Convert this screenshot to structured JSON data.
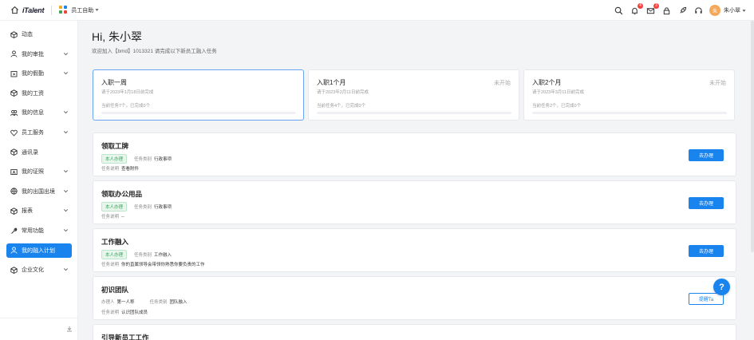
{
  "topbar": {
    "logo": "iTalent",
    "app_switch_label": "员工自助",
    "badges": {
      "bell": "4",
      "mail": "3"
    },
    "user_avatar": "朱",
    "user_name": "朱小翠",
    "icons": [
      "search-icon",
      "bell-icon",
      "mail-icon",
      "lock-icon",
      "rocket-icon",
      "headset-icon"
    ]
  },
  "sidebar": {
    "items": [
      {
        "label": "动态",
        "icon": "cube-icon",
        "chevron": false
      },
      {
        "label": "我的审批",
        "icon": "user-icon",
        "chevron": true
      },
      {
        "label": "我的假勤",
        "icon": "calendar-icon",
        "chevron": true
      },
      {
        "label": "我的工资",
        "icon": "cube-icon",
        "chevron": false
      },
      {
        "label": "我的信息",
        "icon": "users-icon",
        "chevron": true
      },
      {
        "label": "员工服务",
        "icon": "heart-icon",
        "chevron": true
      },
      {
        "label": "通讯录",
        "icon": "cube-icon",
        "chevron": false
      },
      {
        "label": "我的证照",
        "icon": "id-card-icon",
        "chevron": true
      },
      {
        "label": "我的出国出境",
        "icon": "globe-icon",
        "chevron": true
      },
      {
        "label": "报表",
        "icon": "cube-icon",
        "chevron": true
      },
      {
        "label": "常用功能",
        "icon": "tool-icon",
        "chevron": true
      },
      {
        "label": "我的融入计划",
        "icon": "user-icon",
        "chevron": false,
        "active": true
      },
      {
        "label": "企业文化",
        "icon": "cube-icon",
        "chevron": true
      }
    ]
  },
  "main": {
    "greeting": "Hi, 朱小翠",
    "subtitle": "欢迎加入【bmd】1013321 请完成以下新员工融入任务",
    "stages": [
      {
        "title": "入职一周",
        "date": "请于2023年1月18日前完成",
        "status": "",
        "progress": "当前任务7个，已完成0个",
        "fraction": 0
      },
      {
        "title": "入职1个月",
        "date": "请于2023年2月11日前完成",
        "status": "未开始",
        "progress": "当前任务4个，已完成0个",
        "fraction": 0
      },
      {
        "title": "入职2个月",
        "date": "请于2023年3月11日前完成",
        "status": "未开始",
        "progress": "当前任务2个，已完成0个",
        "fraction": 0
      }
    ],
    "tasks": [
      {
        "title": "领取工牌",
        "tag": "本人办理",
        "type_label": "任务类别",
        "type_value": "行政事项",
        "desc_label": "任务说明",
        "desc_value": "查看附件",
        "button": "去办理"
      },
      {
        "title": "领取办公用品",
        "tag": "本人办理",
        "type_label": "任务类别",
        "type_value": "行政事项",
        "desc_label": "任务说明",
        "desc_value": "--",
        "button": "去办理"
      },
      {
        "title": "工作融入",
        "tag": "本人办理",
        "type_label": "任务类别",
        "type_value": "工作融入",
        "desc_label": "任务说明",
        "desc_value": "你的直属领导会带领你熟悉你要负责的工作",
        "button": "去办理"
      },
      {
        "title": "初识团队",
        "handler_label": "办理人",
        "handler_value": "第一人称",
        "type_label": "任务类别",
        "type_value": "团队融入",
        "desc_label": "任务说明",
        "desc_value": "认识团队成员",
        "button": "提醒Ta"
      },
      {
        "title": "引导新员工工作"
      }
    ],
    "help_label": "?"
  },
  "colors": {
    "primary": "#1a84ee",
    "tag_green": "#3aa55a",
    "badge_red": "#f5413b"
  }
}
